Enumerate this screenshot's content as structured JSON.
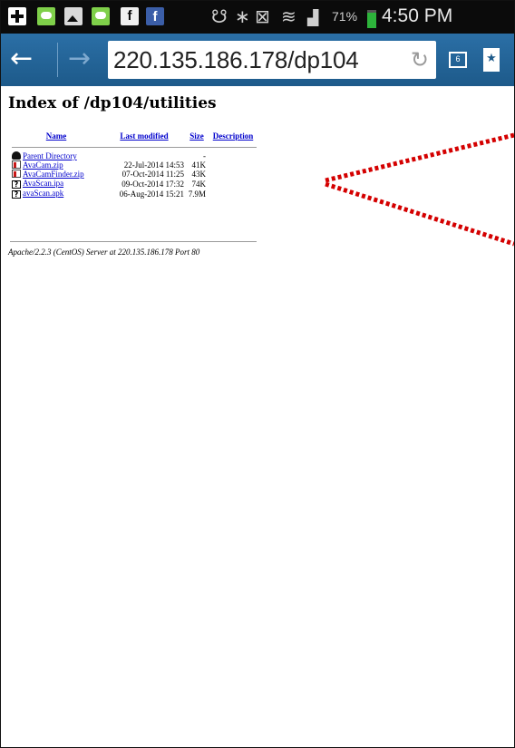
{
  "status_bar": {
    "icons": [
      "plus-icon",
      "chat-icon",
      "gallery-icon",
      "chat-icon",
      "facebook-icon",
      "facebook-icon",
      "eye-icon",
      "bluetooth-icon",
      "nfc-icon",
      "wifi-icon",
      "signal-icon"
    ],
    "fb1_glyph": "f",
    "fb2_glyph": "f",
    "eye_glyph": "☋",
    "bt_glyph": "∗",
    "nfc_glyph": "⊠",
    "wifi_glyph": "≋",
    "signal_glyph": "▟",
    "battery_percent": "71%",
    "battery_level": 0.71,
    "time": "4:50 PM"
  },
  "toolbar": {
    "back_glyph": "←",
    "forward_glyph": "→",
    "url": "220.135.186.178/dp104",
    "reload_glyph": "↻",
    "tab_count": "6",
    "bookmark_glyph": "★"
  },
  "page": {
    "title": "Index of /dp104/utilities",
    "columns": {
      "name": "Name",
      "last_modified": "Last modified",
      "size": "Size",
      "description": "Description"
    },
    "rows": [
      {
        "icon": "back-icon",
        "name": "Parent Directory",
        "date": "",
        "size": "-",
        "desc": ""
      },
      {
        "icon": "zip-icon",
        "name": "AvaCam.zip",
        "date": "22-Jul-2014 14:53",
        "size": "41K",
        "desc": ""
      },
      {
        "icon": "zip-icon",
        "name": "AvaCamFinder.zip",
        "date": "07-Oct-2014 11:25",
        "size": "43K",
        "desc": ""
      },
      {
        "icon": "unknown-file-icon",
        "name": "AvaScan.ipa",
        "date": "09-Oct-2014 17:32",
        "size": "74K",
        "desc": ""
      },
      {
        "icon": "unknown-file-icon",
        "name": "avaScan.apk",
        "date": "06-Aug-2014 15:21",
        "size": "7.9M",
        "desc": ""
      }
    ],
    "server_signature": "Apache/2.2.3 (CentOS) Server at 220.135.186.178 Port 80",
    "unknown_glyph": "?"
  },
  "colors": {
    "toolbar": "#1d5a8a",
    "link": "#0000cc",
    "annotation": "#d40000"
  }
}
